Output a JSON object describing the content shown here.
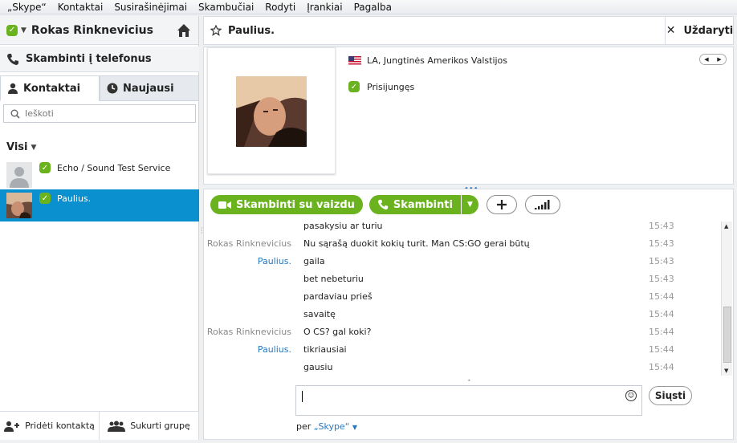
{
  "menu": [
    "„Skype“",
    "Kontaktai",
    "Susirašinėjimai",
    "Skambučiai",
    "Rodyti",
    "Įrankiai",
    "Pagalba"
  ],
  "profile": {
    "name": "Rokas Rinknevicius"
  },
  "call_phones": "Skambinti į telefonus",
  "tabs": {
    "contacts": "Kontaktai",
    "recent": "Naujausi"
  },
  "search": {
    "placeholder": "Ieškoti"
  },
  "filter": "Visi",
  "contacts": [
    {
      "name": "Echo / Sound Test Service"
    },
    {
      "name": "Paulius."
    }
  ],
  "bottom": {
    "add_contact": "Pridėti kontaktą",
    "create_group": "Sukurti grupę"
  },
  "conversation": {
    "title": "Paulius.",
    "close": "Uždaryti",
    "location": "LA, Jungtinės Amerikos Valstijos",
    "status": "Prisijungęs",
    "video_call": "Skambinti su vaizdu",
    "call": "Skambinti",
    "send": "Siųsti",
    "via_prefix": "per",
    "via_network": "„Skype“"
  },
  "messages": [
    {
      "from": "",
      "from_type": "",
      "text": "pasakysiu ar turiu",
      "time": "15:43"
    },
    {
      "from": "Rokas Rinknevicius",
      "from_type": "me",
      "text": "Nu sąrašą duokit kokių turit. Man CS:GO gerai būtų",
      "time": "15:43"
    },
    {
      "from": "Paulius.",
      "from_type": "p",
      "text": "gaila",
      "time": "15:43"
    },
    {
      "from": "",
      "from_type": "",
      "text": "bet nebeturiu",
      "time": "15:43"
    },
    {
      "from": "",
      "from_type": "",
      "text": "pardaviau prieš",
      "time": "15:44"
    },
    {
      "from": "",
      "from_type": "",
      "text": "savaitę",
      "time": "15:44"
    },
    {
      "from": "Rokas Rinknevicius",
      "from_type": "me",
      "text": "O CS? gal koki?",
      "time": "15:44"
    },
    {
      "from": "Paulius.",
      "from_type": "p",
      "text": "tikriausiai",
      "time": "15:44"
    },
    {
      "from": "",
      "from_type": "",
      "text": "gausiu",
      "time": "15:44"
    }
  ],
  "colors": {
    "skype_green": "#6ab21e",
    "selection_blue": "#0a8fcf",
    "link_blue": "#2a78c0"
  }
}
